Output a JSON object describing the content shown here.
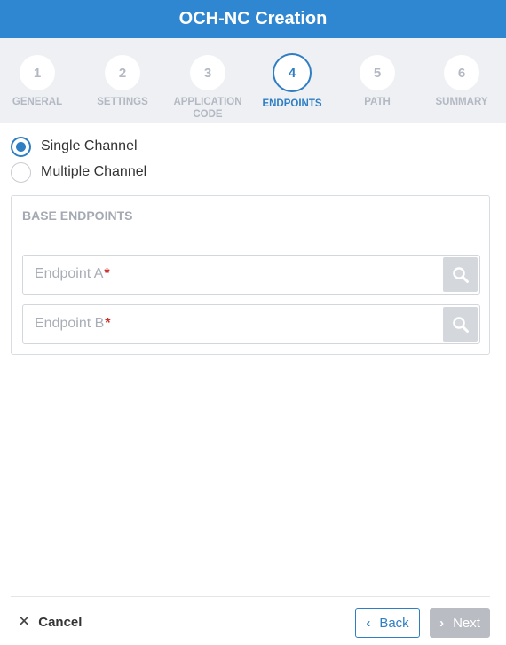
{
  "header": {
    "title": "OCH-NC Creation"
  },
  "stepper": {
    "steps": [
      {
        "number": "1",
        "label": "GENERAL"
      },
      {
        "number": "2",
        "label": "SETTINGS"
      },
      {
        "number": "3",
        "label": "APPLICATION CODE"
      },
      {
        "number": "4",
        "label": "ENDPOINTS"
      },
      {
        "number": "5",
        "label": "PATH"
      },
      {
        "number": "6",
        "label": "SUMMARY"
      }
    ],
    "active_step": "4"
  },
  "channel_mode": {
    "options": [
      {
        "label": "Single Channel",
        "checked": true
      },
      {
        "label": "Multiple Channel",
        "checked": false
      }
    ]
  },
  "base_endpoints": {
    "title": "BASE ENDPOINTS",
    "endpoint_a": {
      "placeholder": "Endpoint A",
      "required_mark": "*"
    },
    "endpoint_b": {
      "placeholder": "Endpoint B",
      "required_mark": "*"
    }
  },
  "footer": {
    "cancel_label": "Cancel",
    "back_label": "Back",
    "next_label": "Next"
  },
  "colors": {
    "header": "#2f86d1",
    "accent": "#2f7ec4",
    "required": "#d0312d",
    "disabled_button": "#b9bcc2"
  }
}
